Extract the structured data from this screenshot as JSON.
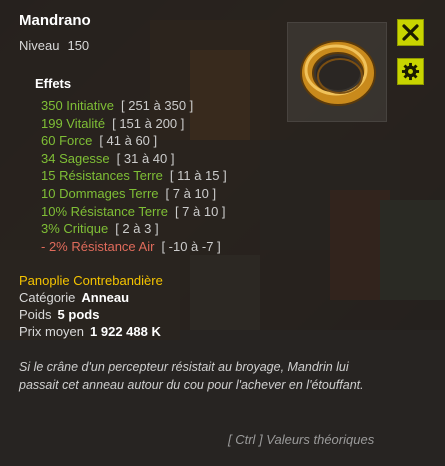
{
  "item": {
    "name": "Mandrano",
    "level_label": "Niveau",
    "level": "150",
    "image": "golden-ring-icon"
  },
  "buttons": {
    "close_icon": "close-icon",
    "options_icon": "gear-icon"
  },
  "effects": {
    "title": "Effets",
    "list": [
      {
        "value": "350 Initiative",
        "range": "[ 251 à 350 ]",
        "negative": false
      },
      {
        "value": "199 Vitalité",
        "range": "[ 151 à 200 ]",
        "negative": false
      },
      {
        "value": "60 Force",
        "range": "[ 41 à 60 ]",
        "negative": false
      },
      {
        "value": "34 Sagesse",
        "range": "[ 31 à 40 ]",
        "negative": false
      },
      {
        "value": "15 Résistances Terre",
        "range": "[ 11 à 15 ]",
        "negative": false
      },
      {
        "value": "10 Dommages Terre",
        "range": "[ 7 à 10 ]",
        "negative": false
      },
      {
        "value": "10% Résistance Terre",
        "range": "[ 7 à 10 ]",
        "negative": false
      },
      {
        "value": "3% Critique",
        "range": "[ 2 à 3 ]",
        "negative": false
      },
      {
        "value": "- 2% Résistance Air",
        "range": "[ -10 à -7 ]",
        "negative": true
      }
    ]
  },
  "details": {
    "set_name": "Panoplie Contrebandière",
    "category_label": "Catégorie",
    "category": "Anneau",
    "weight_label": "Poids",
    "weight": "5 pods",
    "price_label": "Prix moyen",
    "price": "1 922 488 K"
  },
  "description": "Si le crâne d'un percepteur résistait au broyage, Mandrin lui passait cet anneau autour du cou pour l'achever en l'étouffant.",
  "footer": "[ Ctrl ] Valeurs théoriques",
  "colors": {
    "effect_positive": "#7fbf36",
    "effect_negative": "#e06b5b",
    "set_name": "#f5c400",
    "button_bg": "#c8d400"
  }
}
